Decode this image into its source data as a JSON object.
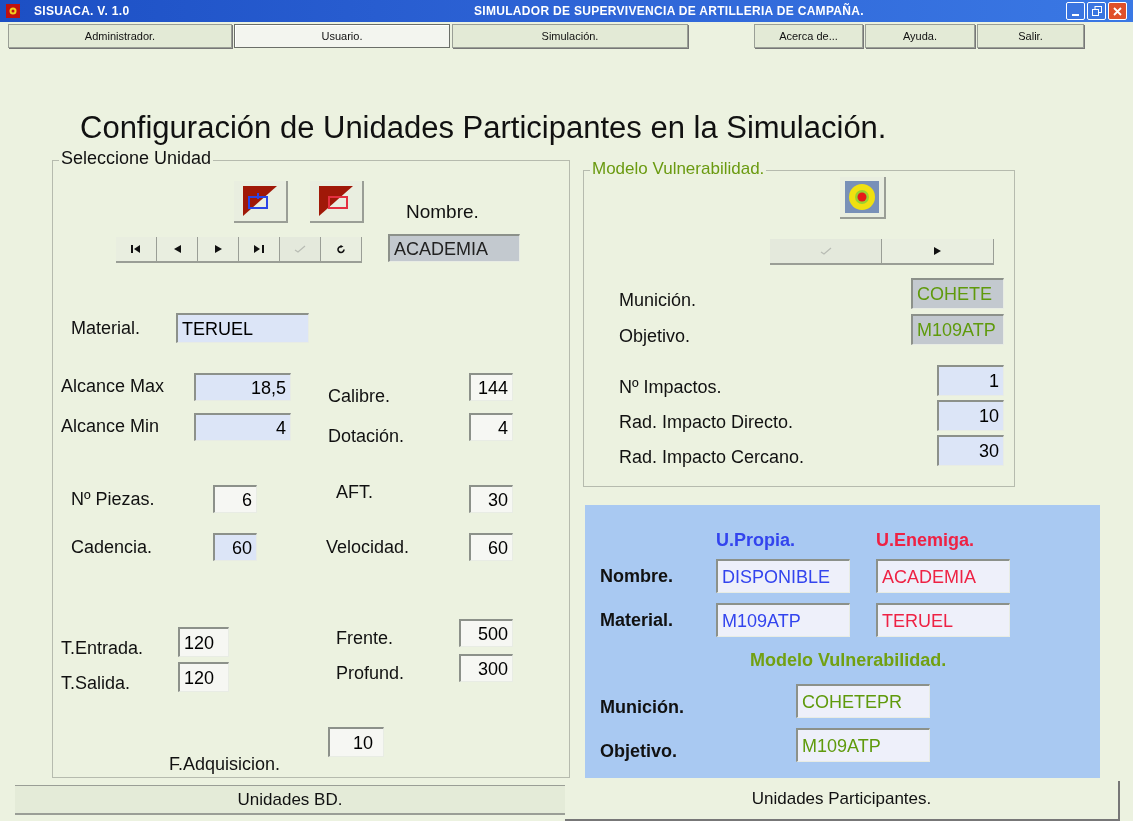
{
  "window": {
    "app_title": "SISUACA. V. 1.0",
    "title": "SIMULADOR DE SUPERVIVENCIA DE ARTILLERIA DE CAMPAÑA."
  },
  "menu": [
    {
      "label": "Administrador.",
      "selected": false
    },
    {
      "label": "Usuario.",
      "selected": true
    },
    {
      "label": "Simulación.",
      "selected": false
    },
    {
      "label": "Acerca de...",
      "selected": false
    },
    {
      "label": "Ayuda.",
      "selected": false
    },
    {
      "label": "Salir.",
      "selected": false
    }
  ],
  "heading": "Configuración de Unidades Participantes en la Simulación.",
  "select_unit": {
    "legend": "Seleccione Unidad",
    "name_label": "Nombre.",
    "name_value": {
      "value": "ACADEMIA",
      "kind": "grey"
    },
    "nav": [
      {
        "kind": "first",
        "disabled": false
      },
      {
        "kind": "prev",
        "disabled": false
      },
      {
        "kind": "next",
        "disabled": false
      },
      {
        "kind": "last",
        "disabled": false
      },
      {
        "kind": "confirm",
        "disabled": true
      },
      {
        "kind": "refresh",
        "disabled": false
      }
    ],
    "material": {
      "label": "Material.",
      "value": "TERUEL",
      "kind": "tinted"
    },
    "range_rows": [
      {
        "left": {
          "label": "Alcance Max",
          "value": "18,5",
          "kind": "tinted"
        },
        "right": {
          "label": "Calibre.",
          "value": "144",
          "kind": "plain"
        }
      },
      {
        "left": {
          "label": "Alcance Min",
          "value": "4",
          "kind": "tinted"
        },
        "right": {
          "label": "Dotación.",
          "value": "4",
          "kind": "plain"
        }
      }
    ],
    "fire_rows": [
      {
        "left": {
          "label": "Nº Piezas.",
          "value": "6",
          "kind": "plain"
        },
        "right": {
          "label": "AFT.",
          "value": "30",
          "kind": "plain"
        }
      },
      {
        "left": {
          "label": "Cadencia.",
          "value": "60",
          "kind": "tinted"
        },
        "right": {
          "label": "Velocidad.",
          "value": "60",
          "kind": "plain"
        }
      }
    ],
    "time_fields": [
      {
        "label": "T.Entrada.",
        "value": "120",
        "kind": "plain"
      },
      {
        "label": "T.Salida.",
        "value": "120",
        "kind": "plain"
      }
    ],
    "area_fields": [
      {
        "label": "Frente.",
        "value": "500",
        "kind": "plain"
      },
      {
        "label": "Profund.",
        "value": "300",
        "kind": "plain"
      }
    ],
    "acquisition": {
      "label": "F.Adquisicion.",
      "value": "10",
      "kind": "plain"
    }
  },
  "vulnerability": {
    "legend": "Modelo Vulnerabilidad.",
    "nav": [
      {
        "kind": "confirm",
        "disabled": true
      },
      {
        "kind": "next",
        "disabled": false
      }
    ],
    "ammo_fields": [
      {
        "label": "Munición.",
        "value": "COHETE",
        "kind": "grey"
      },
      {
        "label": "Objetivo.",
        "value": "M109ATP",
        "kind": "grey"
      }
    ],
    "impact_fields": [
      {
        "label": "Nº Impactos.",
        "value": "1",
        "kind": "tinted"
      },
      {
        "label": "Rad. Impacto Directo.",
        "value": "10",
        "kind": "tinted"
      },
      {
        "label": "Rad. Impacto Cercano.",
        "value": "30",
        "kind": "tinted"
      }
    ]
  },
  "summary": {
    "columns": [
      {
        "label": "U.Propia.",
        "color": "#3344ee"
      },
      {
        "label": "U.Enemiga.",
        "color": "#ee2244"
      }
    ],
    "rows": [
      {
        "label": "Nombre.",
        "values": [
          "DISPONIBLE",
          "ACADEMIA"
        ]
      },
      {
        "label": "Material.",
        "values": [
          "M109ATP",
          "TERUEL"
        ]
      }
    ],
    "model_heading": "Modelo Vulnerabilidad.",
    "model_rows": [
      {
        "label": "Munición.",
        "value": "COHETEPR"
      },
      {
        "label": "Objetivo.",
        "value": "M109ATP"
      }
    ]
  },
  "bottom_tabs": [
    {
      "label": "Unidades BD.",
      "selected": false
    },
    {
      "label": "Unidades Participantes.",
      "selected": true
    }
  ]
}
